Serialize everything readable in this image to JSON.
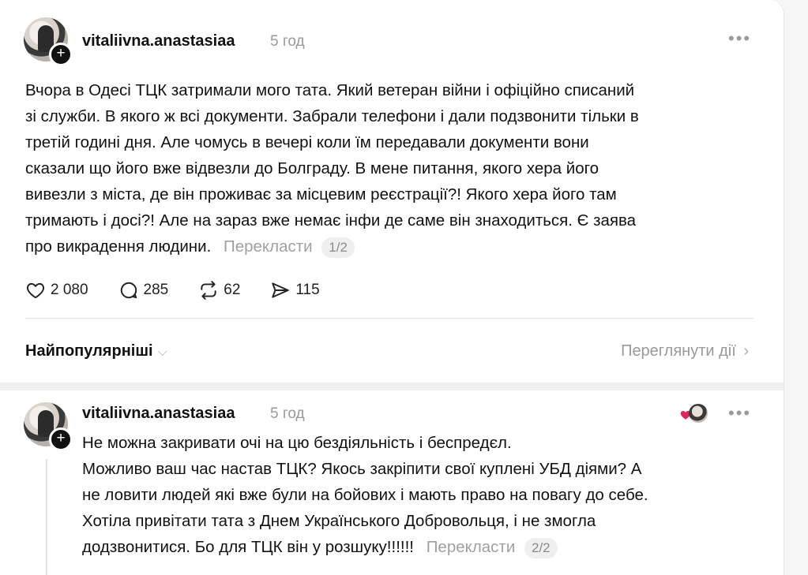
{
  "post": {
    "username": "vitaliivna.anastasiaa",
    "time": "5 год",
    "text_lines": [
      "Вчора в Одесі ТЦК затримали мого тата. Який ветеран війни і офіційно списаний",
      "зі служби. В якого ж всі документи. Забрали телефони і дали подзвонити тільки в",
      "третій годині дня. Але чомусь в вечері коли їм передавали документи вони",
      "сказали що його вже відвезли до Болграду. В мене питання, якого хера його",
      "вивезли з міста, де він проживає за місцевим реєстрації?! Якого хера його там",
      "тримають і досі?! Але на зараз вже немає інфи де саме він знаходиться. Є заява",
      "про викрадення людини."
    ],
    "translate_label": "Перекласти",
    "pager": "1/2",
    "stats": {
      "likes": "2 080",
      "replies": "285",
      "reposts": "62",
      "shares": "115"
    }
  },
  "sort": {
    "label": "Найпопулярніші",
    "view_activity": "Переглянути дії"
  },
  "reply": {
    "username": "vitaliivna.anastasiaa",
    "time": "5 год",
    "text_lines": [
      "Не можна закривати очі на цю бездіяльність і беспредєл.",
      "Можливо ваш час настав ТЦК? Якось закріпити свої куплені УБД діями? А",
      "не ловити людей які вже були на бойових і мають право на повагу до себе.",
      "Хотіла привітати тата з Днем Українського Добровольця, і не змогла",
      "додзвонитися. Бо для ТЦК він у розшуку!!!!!!"
    ],
    "translate_label": "Перекласти",
    "pager": "2/2"
  },
  "icons": {
    "like": "heart-icon",
    "reply": "comment-icon",
    "repost": "repost-icon",
    "share": "send-icon",
    "more": "more-icon"
  },
  "colors": {
    "muted": "#9a9a9a",
    "accent_heart": "#e0245e"
  }
}
